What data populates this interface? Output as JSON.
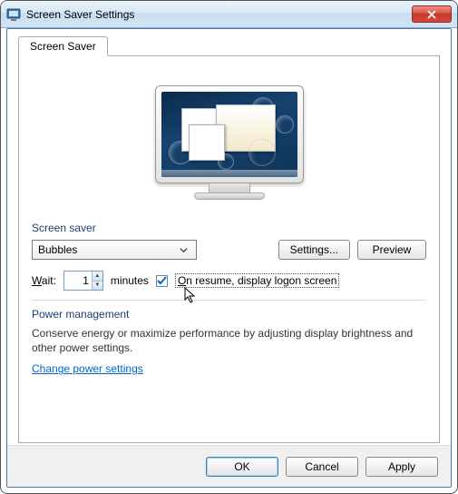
{
  "window": {
    "title": "Screen Saver Settings"
  },
  "tab": {
    "label": "Screen Saver"
  },
  "screensaver": {
    "group_label": "Screen saver",
    "selected": "Bubbles",
    "settings_btn": "Settings...",
    "preview_btn": "Preview"
  },
  "wait": {
    "label_prefix": "W",
    "label_rest": "ait:",
    "value": "1",
    "unit": "minutes",
    "resume_prefix": "O",
    "resume_rest": "n resume, display logon screen",
    "checked": true
  },
  "power": {
    "group_label": "Power management",
    "desc": "Conserve energy or maximize performance by adjusting display brightness and other power settings.",
    "link": "Change power settings"
  },
  "buttons": {
    "ok": "OK",
    "cancel": "Cancel",
    "apply": "Apply"
  }
}
